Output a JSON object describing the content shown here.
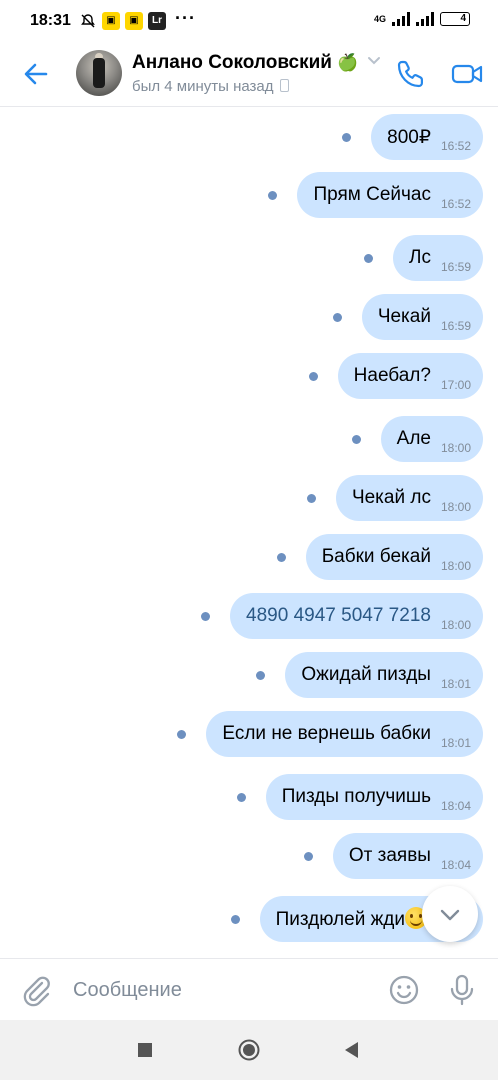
{
  "status_bar": {
    "time": "18:31",
    "badge_lr": "Lr",
    "network": "4G",
    "battery": "4"
  },
  "header": {
    "name": "Анлано Соколовский",
    "name_emoji": "🍏",
    "last_seen": "был 4 минуты назад"
  },
  "messages": [
    {
      "text": "800₽",
      "time": "16:52"
    },
    {
      "text": "Прям Сейчас",
      "time": "16:52"
    },
    {
      "text": "Лс",
      "time": "16:59"
    },
    {
      "text": "Чекай",
      "time": "16:59"
    },
    {
      "text": "Наебал?",
      "time": "17:00"
    },
    {
      "text": "Але",
      "time": "18:00"
    },
    {
      "text": "Чекай лс",
      "time": "18:00"
    },
    {
      "text": "Бабки бекай",
      "time": "18:00"
    },
    {
      "text": "4890 4947 5047 7218",
      "time": "18:00"
    },
    {
      "text": "Ожидай пизды",
      "time": "18:01"
    },
    {
      "text": "Если не вернешь бабки",
      "time": "18:01"
    },
    {
      "text": "Пизды получишь",
      "time": "18:04"
    },
    {
      "text": "От заявы",
      "time": "18:04"
    },
    {
      "text": "Пиздюлей жди",
      "time": ""
    }
  ],
  "composer": {
    "placeholder": "Сообщение"
  },
  "colors": {
    "accent": "#2688eb",
    "bubble": "#cce4ff",
    "unread_dot": "#6d90c0",
    "link": "#2a5885"
  },
  "icons": [
    "back-arrow-icon",
    "phone-icon",
    "video-camera-icon",
    "chevron-down-icon",
    "paperclip-icon",
    "smile-icon",
    "microphone-icon",
    "scroll-down-icon"
  ]
}
